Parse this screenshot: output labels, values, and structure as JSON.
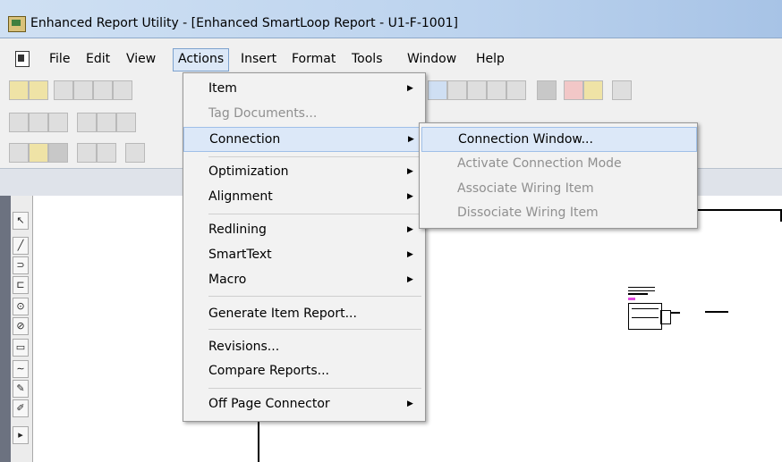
{
  "window": {
    "title": "Enhanced Report Utility - [Enhanced SmartLoop Report - U1-F-1001]"
  },
  "menubar": {
    "items": [
      "File",
      "Edit",
      "View",
      "Actions",
      "Insert",
      "Format",
      "Tools",
      "Window",
      "Help"
    ],
    "active": "Actions"
  },
  "actions_menu": {
    "items": [
      {
        "label": "Item",
        "submenu": true,
        "enabled": true
      },
      {
        "label": "Tag Documents...",
        "submenu": false,
        "enabled": false
      },
      {
        "label": "Connection",
        "submenu": true,
        "enabled": true,
        "highlighted": true
      },
      {
        "label": "Optimization",
        "submenu": true,
        "enabled": true
      },
      {
        "label": "Alignment",
        "submenu": true,
        "enabled": true
      },
      {
        "label": "Redlining",
        "submenu": true,
        "enabled": true
      },
      {
        "label": "SmartText",
        "submenu": true,
        "enabled": true
      },
      {
        "label": "Macro",
        "submenu": true,
        "enabled": true
      },
      {
        "label": "Generate Item Report...",
        "submenu": false,
        "enabled": true
      },
      {
        "label": "Revisions...",
        "submenu": false,
        "enabled": true
      },
      {
        "label": "Compare Reports...",
        "submenu": false,
        "enabled": true
      },
      {
        "label": "Off Page Connector",
        "submenu": true,
        "enabled": true
      }
    ]
  },
  "connection_submenu": {
    "items": [
      {
        "label": "Connection Window...",
        "enabled": true,
        "highlighted": true
      },
      {
        "label": "Activate Connection Mode",
        "enabled": false
      },
      {
        "label": "Associate Wiring Item",
        "enabled": false
      },
      {
        "label": "Dissociate Wiring Item",
        "enabled": false
      }
    ]
  },
  "icons": {
    "app": "report-utility-icon",
    "document": "document-icon",
    "submenu_arrow": "chevron-right-icon"
  },
  "colors": {
    "menu_highlight": "#dce8f8",
    "disabled_text": "#8f8f8f",
    "canvas": "#ffffff"
  }
}
